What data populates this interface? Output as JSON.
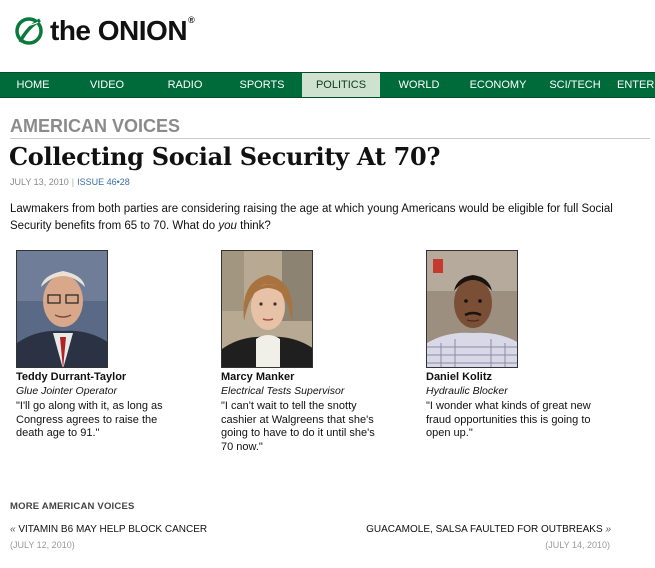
{
  "header": {
    "logo_text": "the ONION",
    "logo_reg": "®"
  },
  "nav": {
    "items": [
      {
        "label": "HOME"
      },
      {
        "label": "VIDEO"
      },
      {
        "label": "RADIO"
      },
      {
        "label": "SPORTS"
      },
      {
        "label": "POLITICS",
        "active": true
      },
      {
        "label": "WORLD"
      },
      {
        "label": "ECONOMY"
      },
      {
        "label": "SCI/TECH"
      },
      {
        "label": "ENTER"
      }
    ],
    "colors": {
      "bar": "#006b3a",
      "active_bg": "#cfe2cf"
    }
  },
  "article": {
    "section": "AMERICAN VOICES",
    "title": "Collecting Social Security At 70?",
    "date": "JULY 13, 2010",
    "separator": "|",
    "issue": "ISSUE 46•28",
    "lede_before": "Lawmakers from both parties are considering raising the age at which young Americans would be eligible for full Social Security benefits from 65 to 70. What do ",
    "lede_em": "you",
    "lede_after": " think?"
  },
  "voices": [
    {
      "name": "Teddy Durrant-Taylor",
      "job": "Glue Jointer Operator",
      "quote": "\"I'll go along with it, as long as Congress agrees to raise the death age to 91.\""
    },
    {
      "name": "Marcy Manker",
      "job": "Electrical Tests Supervisor",
      "quote": "\"I can't wait to tell the snotty cashier at Walgreens that she's going to have to do it until she's 70 now.\""
    },
    {
      "name": "Daniel Kolitz",
      "job": "Hydraulic Blocker",
      "quote": "\"I wonder what kinds of great new fraud opportunities this is going to open up.\""
    }
  ],
  "more": {
    "title": "MORE AMERICAN VOICES",
    "prev": {
      "arrow": "«",
      "label": "VITAMIN B6 MAY HELP BLOCK CANCER",
      "date": "(JULY 12, 2010)"
    },
    "next": {
      "arrow": "»",
      "label": "GUACAMOLE, SALSA FAULTED FOR OUTBREAKS",
      "date": "(JULY 14, 2010)"
    }
  }
}
